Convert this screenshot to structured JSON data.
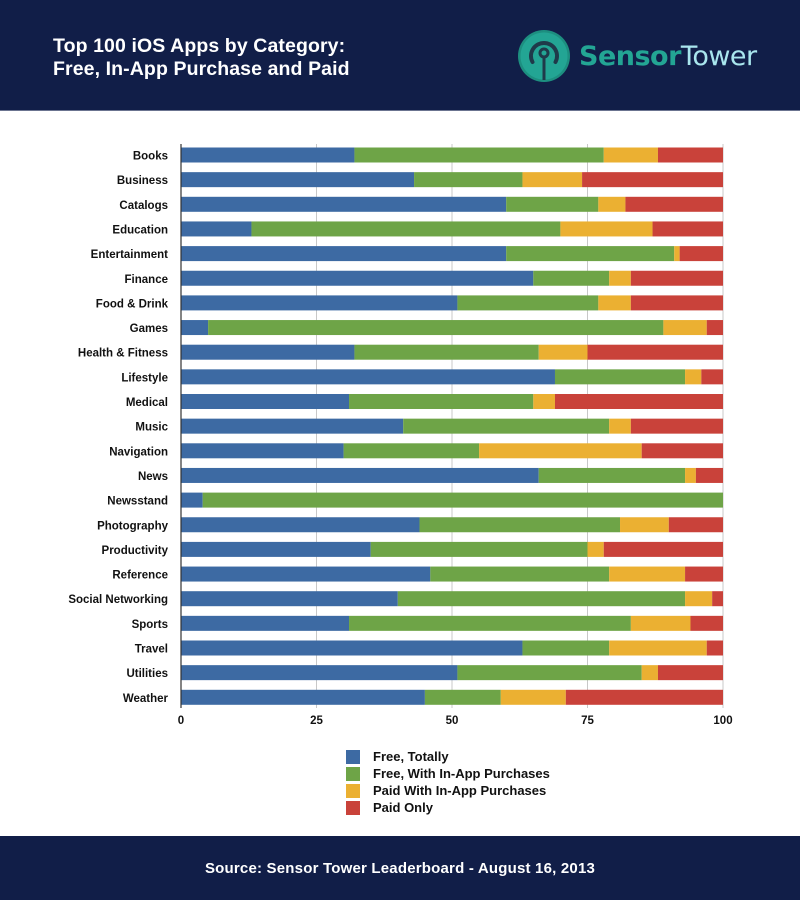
{
  "header": {
    "title_line1": "Top 100 iOS Apps by Category:",
    "title_line2": "Free, In-App Purchase and Paid",
    "logo_sensor": "Sensor",
    "logo_tower": "Tower"
  },
  "footer": {
    "source": "Source: Sensor Tower Leaderboard - August 16, 2013"
  },
  "colors": {
    "header_bg": "#111e48",
    "free_totally": "#3d6aa3",
    "free_iap": "#6ea447",
    "paid_iap": "#ebb032",
    "paid_only": "#c9423a",
    "logo_teal": "#23a594"
  },
  "chart_data": {
    "type": "bar",
    "orientation": "horizontal",
    "stacked": true,
    "title": "Top 100 iOS Apps by Category: Free, In-App Purchase and Paid",
    "xlabel": "",
    "ylabel": "",
    "xlim": [
      0,
      100
    ],
    "xticks": [
      0,
      25,
      50,
      75,
      100
    ],
    "grid": true,
    "legend_position": "bottom-center",
    "categories": [
      "Books",
      "Business",
      "Catalogs",
      "Education",
      "Entertainment",
      "Finance",
      "Food & Drink",
      "Games",
      "Health & Fitness",
      "Lifestyle",
      "Medical",
      "Music",
      "Navigation",
      "News",
      "Newsstand",
      "Photography",
      "Productivity",
      "Reference",
      "Social Networking",
      "Sports",
      "Travel",
      "Utilities",
      "Weather"
    ],
    "series": [
      {
        "name": "Free, Totally",
        "color": "#3d6aa3",
        "values": [
          32,
          43,
          60,
          13,
          60,
          65,
          51,
          5,
          32,
          69,
          31,
          41,
          30,
          66,
          4,
          44,
          35,
          46,
          40,
          31,
          63,
          51,
          45
        ]
      },
      {
        "name": "Free, With In-App Purchases",
        "color": "#6ea447",
        "values": [
          46,
          20,
          17,
          57,
          31,
          14,
          26,
          84,
          34,
          24,
          34,
          38,
          25,
          27,
          96,
          37,
          40,
          33,
          53,
          52,
          16,
          34,
          14
        ]
      },
      {
        "name": "Paid With In-App Purchases",
        "color": "#ebb032",
        "values": [
          10,
          11,
          5,
          17,
          1,
          4,
          6,
          8,
          9,
          3,
          4,
          4,
          30,
          2,
          0,
          9,
          3,
          14,
          5,
          11,
          18,
          3,
          12
        ]
      },
      {
        "name": "Paid Only",
        "color": "#c9423a",
        "values": [
          12,
          26,
          18,
          13,
          8,
          17,
          17,
          3,
          25,
          4,
          31,
          17,
          15,
          5,
          0,
          10,
          22,
          7,
          2,
          6,
          3,
          12,
          29
        ]
      }
    ]
  }
}
